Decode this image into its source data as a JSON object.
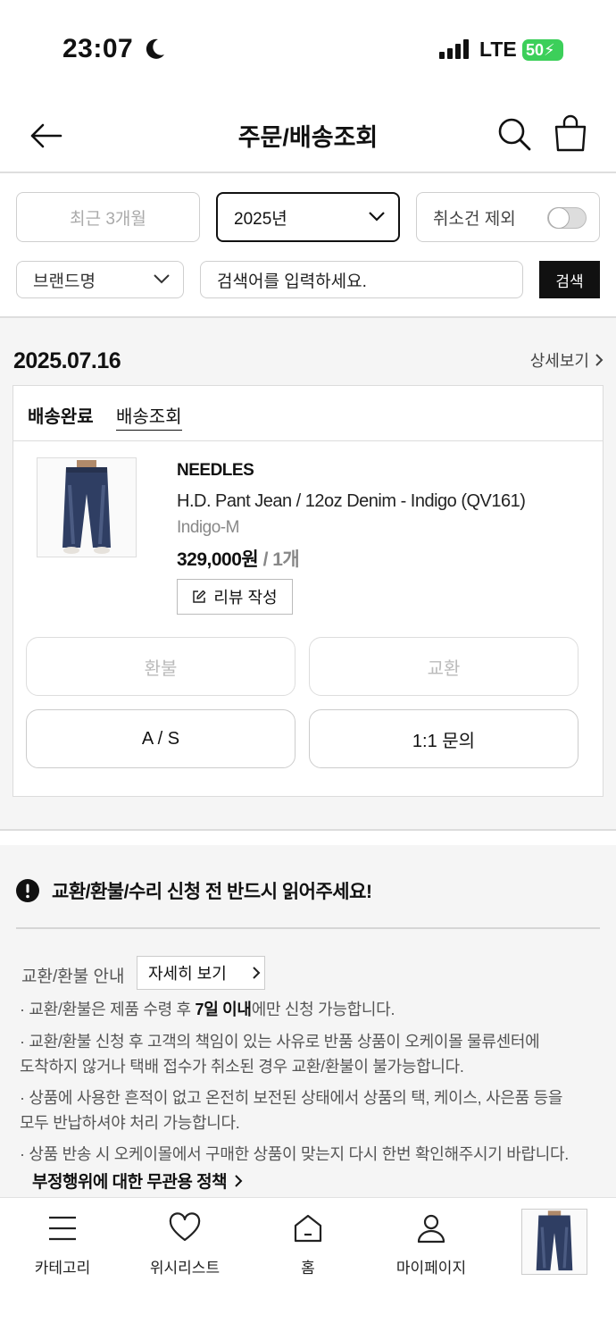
{
  "status_bar": {
    "time": "23:07",
    "network": "LTE",
    "battery": "50"
  },
  "header": {
    "title": "주문/배송조회"
  },
  "filters": {
    "period": "최근 3개월",
    "year": "2025년",
    "exclude_cancelled": "취소건 제외",
    "exclude_cancelled_on": false,
    "brand": "브랜드명",
    "search_placeholder": "검색어를 입력하세요.",
    "search_button": "검색"
  },
  "order": {
    "date": "2025.07.16",
    "detail_link": "상세보기",
    "status": "배송완료",
    "tracking_link": "배송조회",
    "item": {
      "brand": "NEEDLES",
      "name": "H.D. Pant Jean / 12oz Denim - Indigo (QV161)",
      "option": "Indigo-M",
      "price": "329,000원",
      "quantity": "1개",
      "review_button": "리뷰 작성"
    },
    "actions": {
      "refund": "환불",
      "exchange": "교환",
      "as": "A / S",
      "inquiry": "1:1 문의"
    }
  },
  "notice": {
    "title": "교환/환불/수리 신청 전 반드시 읽어주세요!",
    "guide_label": "교환/환불 안내",
    "guide_button": "자세히 보기",
    "line1_pre": "· 교환/환불은 제품 수령 후 ",
    "line1_bold": "7일 이내",
    "line1_post": "에만 신청 가능합니다.",
    "line2a": "· 교환/환불 신청 후 고객의 책임이 있는 사유로 반품 상품이 오케이몰 물류센터에",
    "line2b": "도착하지 않거나 택배 접수가 취소된 경우 교환/환불이 불가능합니다.",
    "line3a": "· 상품에 사용한 흔적이 없고 온전히 보전된 상태에서 상품의 택, 케이스, 사은품 등을",
    "line3b": "모두 반납하셔야 처리 가능합니다.",
    "line4": "· 상품 반송 시 오케이몰에서 구매한 상품이 맞는지 다시 한번 확인해주시기 바랍니다.",
    "policy_link": "부정행위에 대한 무관용 정책"
  },
  "tabbar": {
    "category": "카테고리",
    "wishlist": "위시리스트",
    "home": "홈",
    "mypage": "마이페이지"
  },
  "colors": {
    "accent": "#111111",
    "battery": "#3ccf5a",
    "section_bg": "#f5f5f5"
  }
}
